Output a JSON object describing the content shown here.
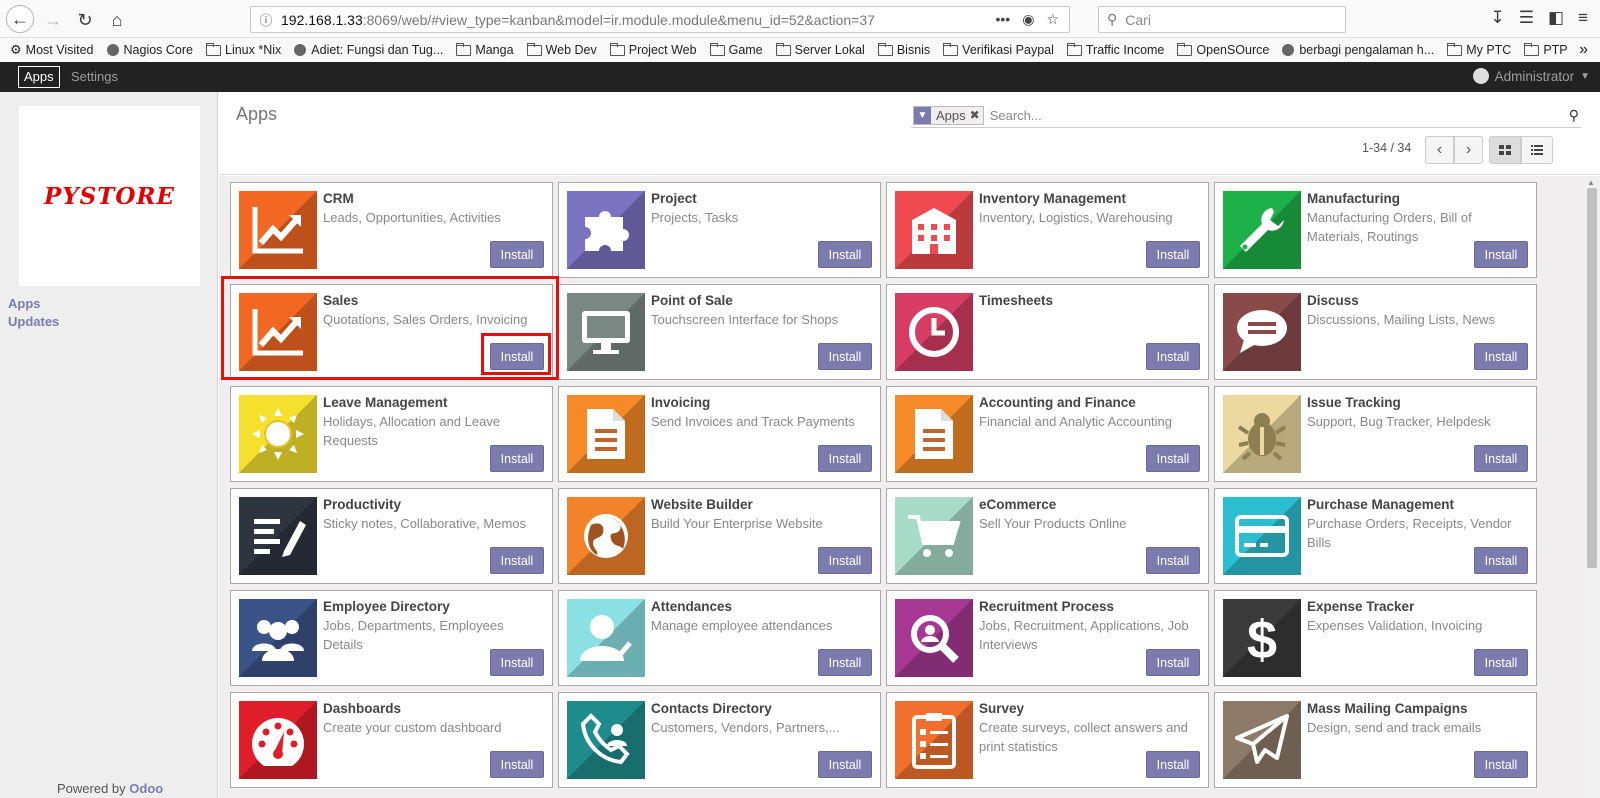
{
  "browser": {
    "url_host": "192.168.1.33",
    "url_path": ":8069/web/#view_type=kanban&model=ir.module.module&menu_id=52&action=37",
    "search_placeholder": "Cari",
    "bookmarks": [
      {
        "label": "Most Visited",
        "icon": "gear-icon"
      },
      {
        "label": "Nagios Core",
        "icon": "globe-icon"
      },
      {
        "label": "Linux *Nix",
        "icon": "folder-icon"
      },
      {
        "label": "Adiet: Fungsi dan Tug...",
        "icon": "globe-icon"
      },
      {
        "label": "Manga",
        "icon": "folder-icon"
      },
      {
        "label": "Web Dev",
        "icon": "folder-icon"
      },
      {
        "label": "Project Web",
        "icon": "folder-icon"
      },
      {
        "label": "Game",
        "icon": "folder-icon"
      },
      {
        "label": "Server Lokal",
        "icon": "folder-icon"
      },
      {
        "label": "Bisnis",
        "icon": "folder-icon"
      },
      {
        "label": "Verifikasi Paypal",
        "icon": "folder-icon"
      },
      {
        "label": "Traffic Income",
        "icon": "folder-icon"
      },
      {
        "label": "OpenSOurce",
        "icon": "folder-icon"
      },
      {
        "label": "berbagi pengalaman h...",
        "icon": "globe-icon"
      },
      {
        "label": "My PTC",
        "icon": "folder-icon"
      },
      {
        "label": "PTP",
        "icon": "folder-icon"
      }
    ]
  },
  "topnav": {
    "apps": "Apps",
    "settings": "Settings",
    "user": "Administrator"
  },
  "sidebar": {
    "logo": "PYSTORE",
    "links": [
      "Apps",
      "Updates"
    ],
    "powered_prefix": "Powered by ",
    "powered_brand": "Odoo"
  },
  "control": {
    "breadcrumb": "Apps",
    "facet": "Apps",
    "search_placeholder": "Search...",
    "pager": "1-34 / 34"
  },
  "install_label": "Install",
  "apps": [
    {
      "title": "CRM",
      "summary": "Leads, Opportunities, Activities",
      "color": "#f26722",
      "icon": "chart-up-icon"
    },
    {
      "title": "Project",
      "summary": "Projects, Tasks",
      "color": "#7b72c0",
      "icon": "puzzle-icon"
    },
    {
      "title": "Inventory Management",
      "summary": "Inventory, Logistics, Warehousing",
      "color": "#ef4a4f",
      "icon": "building-icon"
    },
    {
      "title": "Manufacturing",
      "summary": "Manufacturing Orders, Bill of Materials, Routings",
      "color": "#1eb14a",
      "icon": "wrench-icon"
    },
    {
      "title": "Sales",
      "summary": "Quotations, Sales Orders, Invoicing",
      "color": "#f26722",
      "icon": "chart-up-icon"
    },
    {
      "title": "Point of Sale",
      "summary": "Touchscreen Interface for Shops",
      "color": "#7a8884",
      "icon": "monitor-icon"
    },
    {
      "title": "Timesheets",
      "summary": "",
      "color": "#d63c64",
      "icon": "clock-icon"
    },
    {
      "title": "Discuss",
      "summary": "Discussions, Mailing Lists, News",
      "color": "#8b4a4a",
      "icon": "chat-icon"
    },
    {
      "title": "Leave Management",
      "summary": "Holidays, Allocation and Leave Requests",
      "color": "#f5e02e",
      "icon": "sun-icon"
    },
    {
      "title": "Invoicing",
      "summary": "Send Invoices and Track Payments",
      "color": "#f68a28",
      "icon": "document-icon"
    },
    {
      "title": "Accounting and Finance",
      "summary": "Financial and Analytic Accounting",
      "color": "#f68a28",
      "icon": "document-icon"
    },
    {
      "title": "Issue Tracking",
      "summary": "Support, Bug Tracker, Helpdesk",
      "color": "#ecd9a0",
      "icon": "bug-icon"
    },
    {
      "title": "Productivity",
      "summary": "Sticky notes, Collaborative, Memos",
      "color": "#2d3541",
      "icon": "notes-icon"
    },
    {
      "title": "Website Builder",
      "summary": "Build Your Enterprise Website",
      "color": "#f2832b",
      "icon": "globe-icon"
    },
    {
      "title": "eCommerce",
      "summary": "Sell Your Products Online",
      "color": "#a8dcc9",
      "icon": "cart-icon"
    },
    {
      "title": "Purchase Management",
      "summary": "Purchase Orders, Receipts, Vendor Bills",
      "color": "#2bbdd0",
      "icon": "card-icon"
    },
    {
      "title": "Employee Directory",
      "summary": "Jobs, Departments, Employees Details",
      "color": "#3c5388",
      "icon": "people-icon"
    },
    {
      "title": "Attendances",
      "summary": "Manage employee attendances",
      "color": "#8be0e4",
      "icon": "user-check-icon"
    },
    {
      "title": "Recruitment Process",
      "summary": "Jobs, Recruitment, Applications, Job Interviews",
      "color": "#a63894",
      "icon": "magnifier-icon"
    },
    {
      "title": "Expense Tracker",
      "summary": "Expenses Validation, Invoicing",
      "color": "#3a3a3a",
      "icon": "dollar-icon"
    },
    {
      "title": "Dashboards",
      "summary": "Create your custom dashboard",
      "color": "#e01e2a",
      "icon": "gauge-icon"
    },
    {
      "title": "Contacts Directory",
      "summary": "Customers, Vendors, Partners,...",
      "color": "#1e8c8c",
      "icon": "phone-icon"
    },
    {
      "title": "Survey",
      "summary": "Create surveys, collect answers and print statistics",
      "color": "#f26f2e",
      "icon": "clipboard-icon"
    },
    {
      "title": "Mass Mailing Campaigns",
      "summary": "Design, send and track emails",
      "color": "#8e7a68",
      "icon": "paper-plane-icon"
    }
  ]
}
